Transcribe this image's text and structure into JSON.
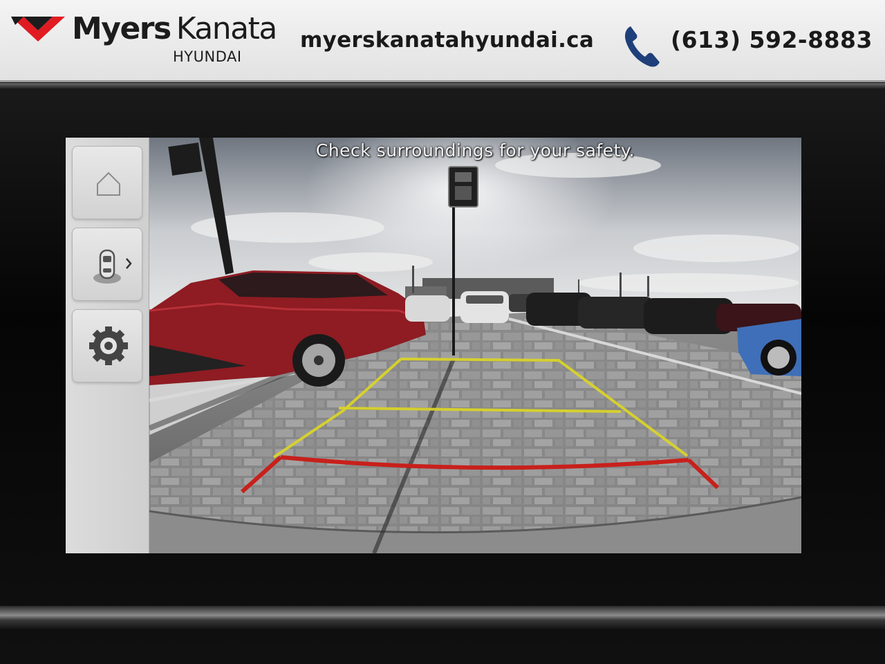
{
  "banner": {
    "brand_primary": "Myers",
    "brand_secondary": "Kanata",
    "brand_sub": "HYUNDAI",
    "website": "myerskanatahyundai.ca",
    "phone": "(613) 592-8883",
    "accent_color": "#e11b22",
    "phone_icon_color": "#1f3f7a"
  },
  "infotainment": {
    "sidebar": [
      {
        "icon": "home-icon"
      },
      {
        "icon": "parking-sensor-view-icon"
      },
      {
        "icon": "camera-settings-icon"
      }
    ],
    "camera_view": {
      "message": "Check surroundings for your safety.",
      "guide_colors": {
        "near": "#c8201b",
        "far": "#d9d32a"
      }
    }
  }
}
